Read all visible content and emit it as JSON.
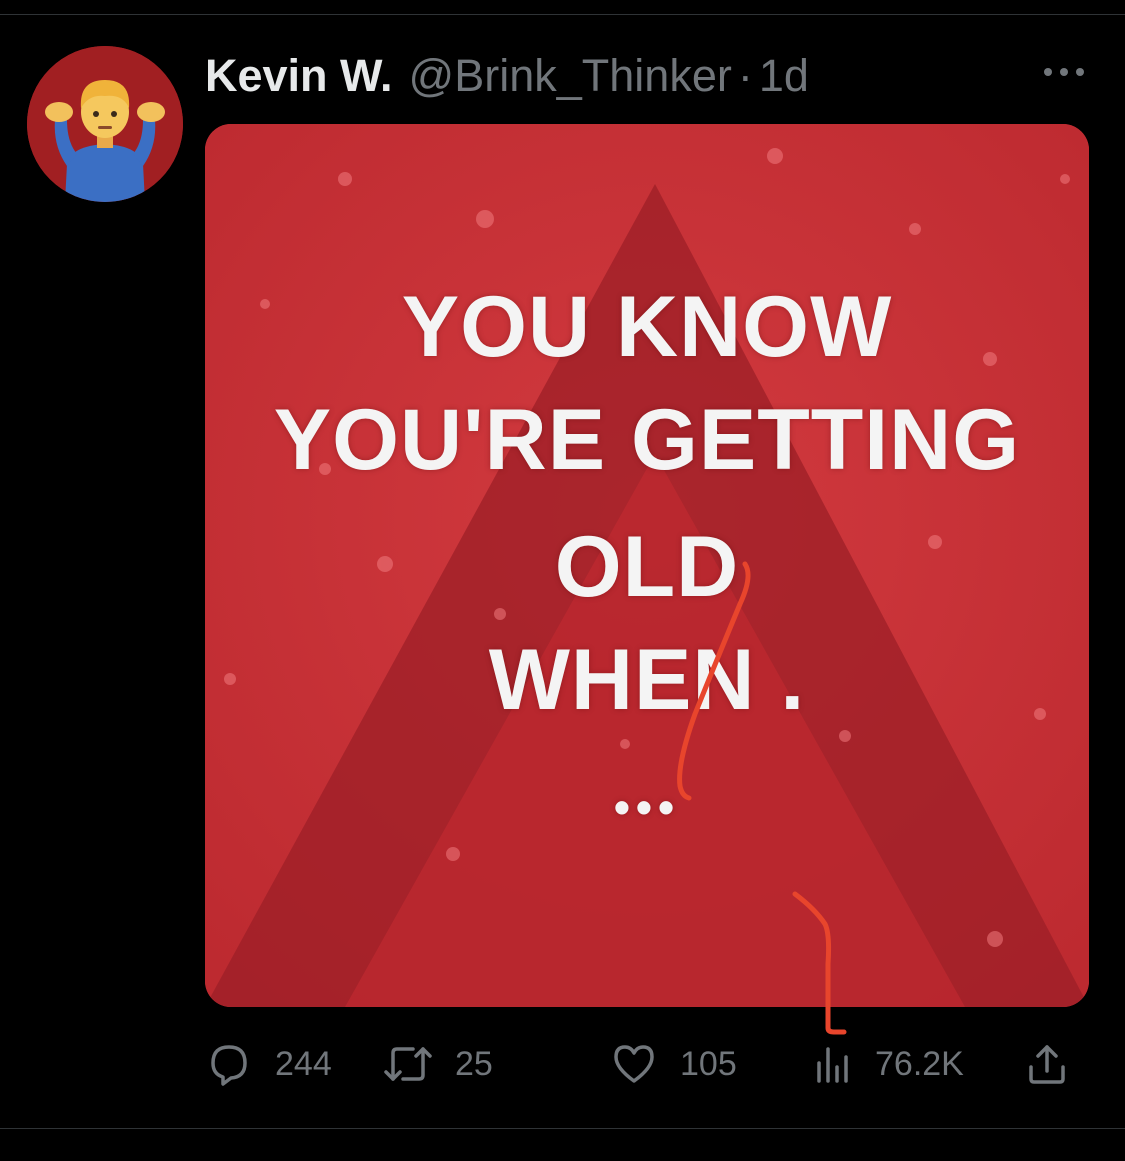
{
  "tweet": {
    "author": {
      "display_name": "Kevin W.",
      "handle": "@Brink_Thinker",
      "avatar_icon": "man-shrugging-emoji-icon"
    },
    "separator": "·",
    "timestamp": "1d",
    "more_icon": "more-horizontal-icon",
    "media": {
      "text_lines": [
        "YOU KNOW",
        "YOU'RE GETTING",
        "OLD",
        "WHEN .",
        "•••"
      ],
      "background_color": "#c52d33",
      "annotation_color": "#e8452c"
    },
    "actions": {
      "reply": {
        "icon": "reply-bubble-icon",
        "count": "244"
      },
      "retweet": {
        "icon": "retweet-icon",
        "count": "25"
      },
      "like": {
        "icon": "heart-icon",
        "count": "105"
      },
      "views": {
        "icon": "views-bar-chart-icon",
        "count": "76.2K"
      },
      "share": {
        "icon": "share-upload-icon"
      }
    }
  },
  "colors": {
    "background": "#000000",
    "primary_text": "#e7e9ea",
    "secondary_text": "#71767b",
    "divider": "#2f3336"
  }
}
